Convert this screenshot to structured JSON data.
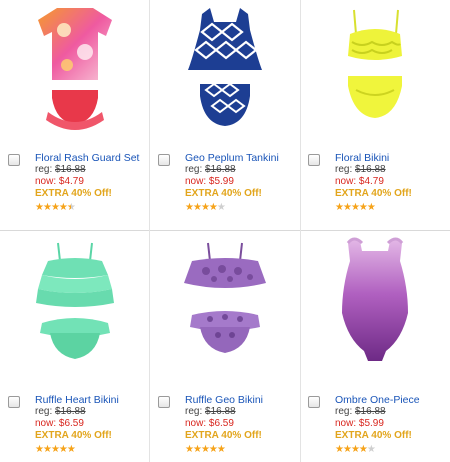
{
  "products": [
    {
      "name": "Floral Rash Guard Set",
      "reg_label": "reg:",
      "reg_price": "$16.88",
      "now_label": "now:",
      "now_price": "$4.79",
      "promo": "EXTRA 40% Off!",
      "rating": 4.5
    },
    {
      "name": "Geo Peplum Tankini",
      "reg_label": "reg:",
      "reg_price": "$16.88",
      "now_label": "now:",
      "now_price": "$5.99",
      "promo": "EXTRA 40% Off!",
      "rating": 4
    },
    {
      "name": "Floral Bikini",
      "reg_label": "reg:",
      "reg_price": "$16.88",
      "now_label": "now:",
      "now_price": "$4.79",
      "promo": "EXTRA 40% Off!",
      "rating": 5
    },
    {
      "name": "Ruffle Heart Bikini",
      "reg_label": "reg:",
      "reg_price": "$16.88",
      "now_label": "now:",
      "now_price": "$6.59",
      "promo": "EXTRA 40% Off!",
      "rating": 5
    },
    {
      "name": "Ruffle Geo Bikini",
      "reg_label": "reg:",
      "reg_price": "$16.88",
      "now_label": "now:",
      "now_price": "$6.59",
      "promo": "EXTRA 40% Off!",
      "rating": 5
    },
    {
      "name": "Ombre One-Piece",
      "reg_label": "reg:",
      "reg_price": "$16.88",
      "now_label": "now:",
      "now_price": "$5.99",
      "promo": "EXTRA 40% Off!",
      "rating": 4
    }
  ],
  "colors": {
    "link": "#1a55b8",
    "sale_price": "#d8261e",
    "promo": "#e2a51c",
    "star_on": "#f6a31a",
    "star_off": "#cfcfcf"
  }
}
